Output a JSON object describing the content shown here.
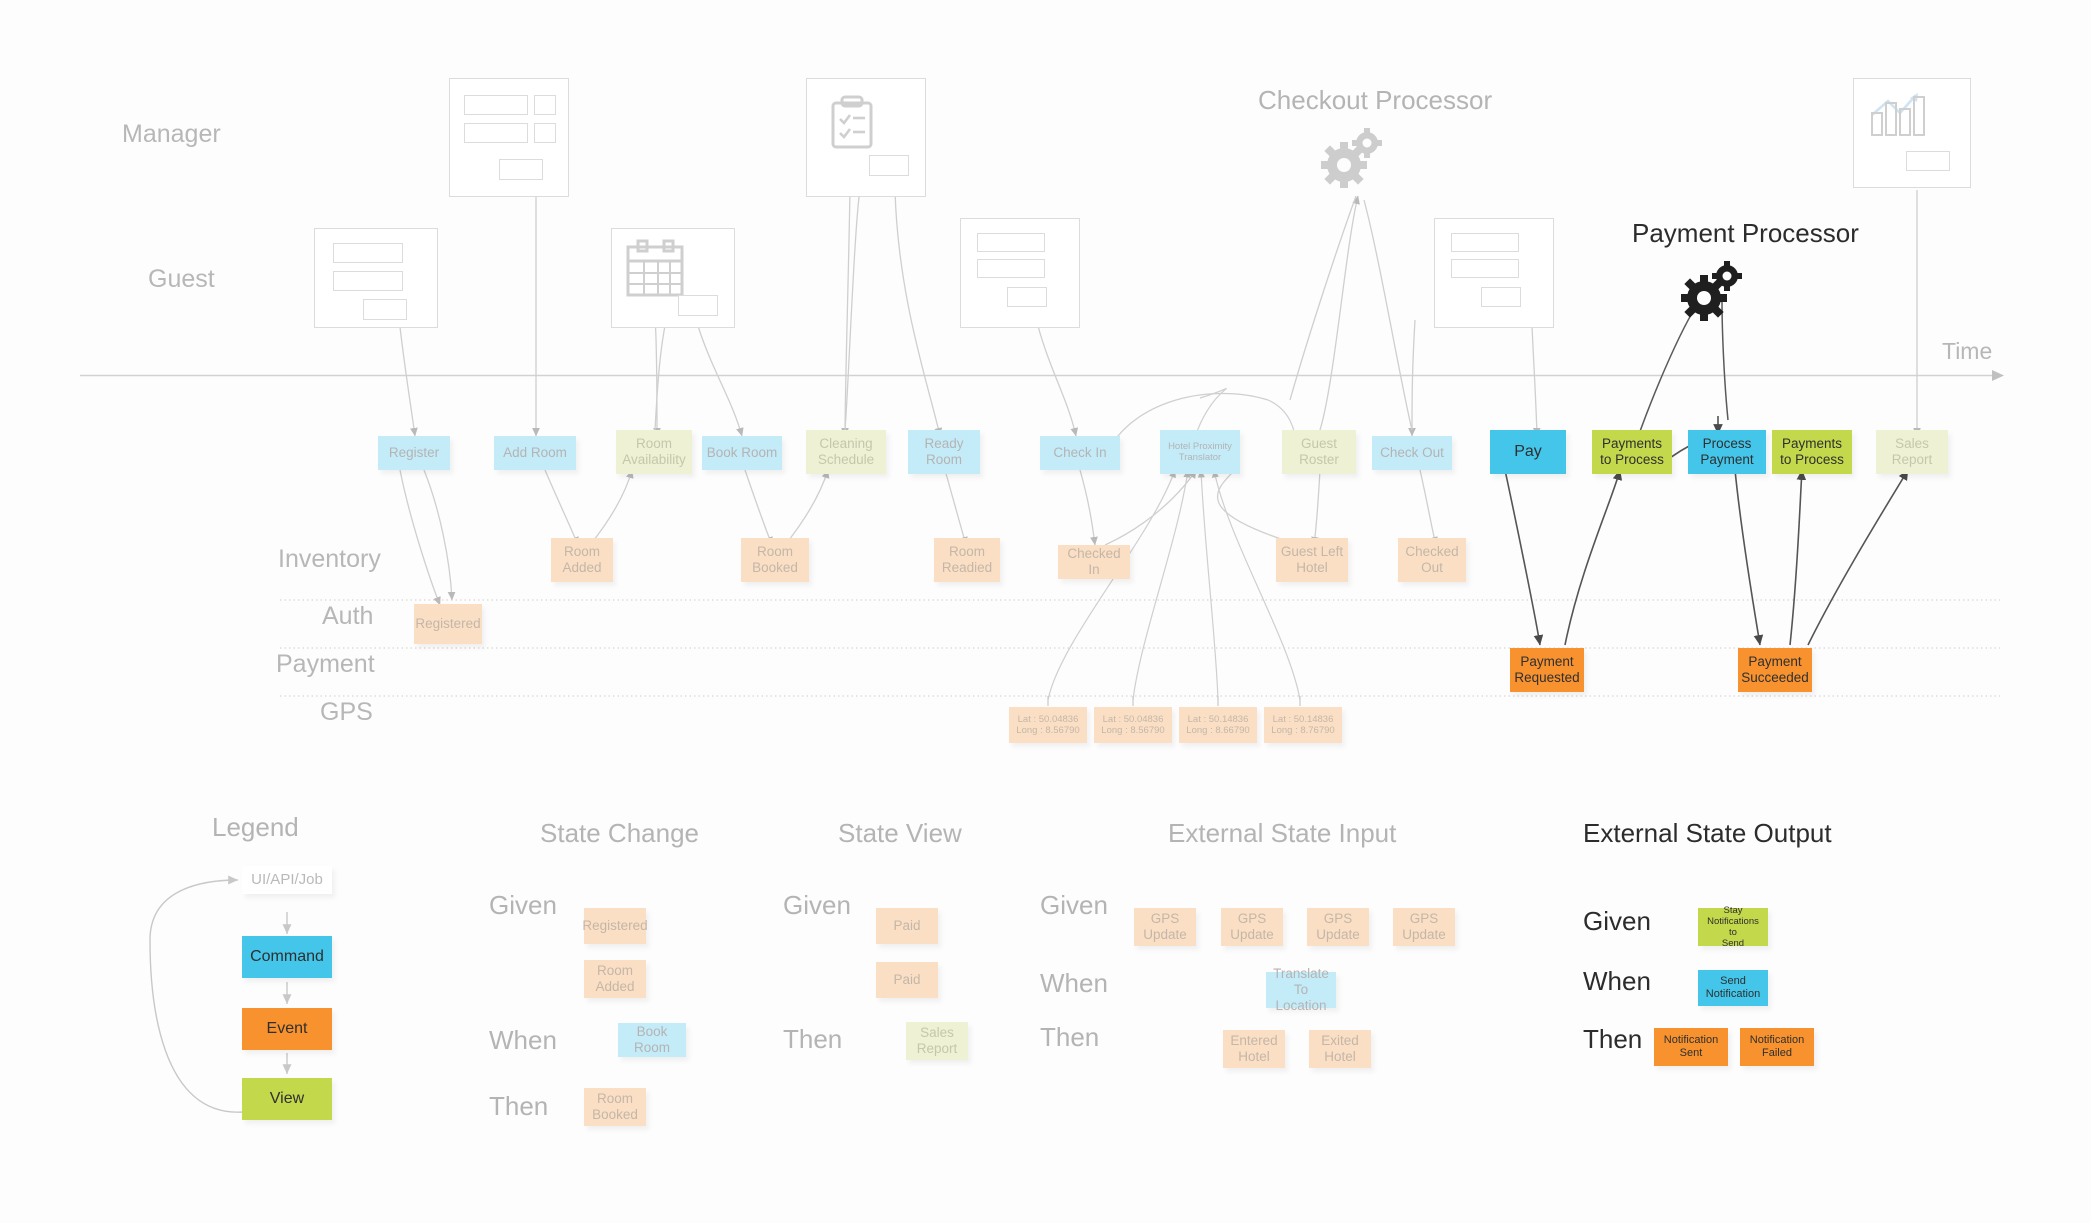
{
  "diagram": {
    "time_axis_label": "Time",
    "lanes": [
      {
        "name": "Manager"
      },
      {
        "name": "Guest"
      },
      {
        "name": "Inventory"
      },
      {
        "name": "Auth"
      },
      {
        "name": "Payment"
      },
      {
        "name": "GPS"
      }
    ],
    "processors": [
      {
        "name": "Checkout Processor",
        "emphasis": "dim"
      },
      {
        "name": "Payment Processor",
        "emphasis": "strong"
      }
    ],
    "timeline_cards": [
      {
        "label": "Register",
        "kind": "command",
        "faded": true
      },
      {
        "label": "Add Room",
        "kind": "command",
        "faded": true
      },
      {
        "label": "Room\nAvailability",
        "kind": "view",
        "faded": true
      },
      {
        "label": "Book Room",
        "kind": "command",
        "faded": true
      },
      {
        "label": "Cleaning\nSchedule",
        "kind": "view",
        "faded": true
      },
      {
        "label": "Ready\nRoom",
        "kind": "command",
        "faded": true
      },
      {
        "label": "Check In",
        "kind": "command",
        "faded": true
      },
      {
        "label": "Hotel Proximity\nTranslator",
        "kind": "command",
        "faded": true
      },
      {
        "label": "Guest\nRoster",
        "kind": "view",
        "faded": true
      },
      {
        "label": "Check Out",
        "kind": "command",
        "faded": true
      },
      {
        "label": "Pay",
        "kind": "command",
        "faded": false
      },
      {
        "label": "Payments\nto Process",
        "kind": "view",
        "faded": false
      },
      {
        "label": "Process\nPayment",
        "kind": "command",
        "faded": false
      },
      {
        "label": "Payments\nto Process",
        "kind": "view",
        "faded": false
      },
      {
        "label": "Sales\nReport",
        "kind": "view",
        "faded": true
      }
    ],
    "inventory_events": [
      {
        "label": "Room\nAdded"
      },
      {
        "label": "Room\nBooked"
      },
      {
        "label": "Room\nReadied"
      },
      {
        "label": "Checked In"
      },
      {
        "label": "Guest Left\nHotel"
      },
      {
        "label": "Checked\nOut"
      }
    ],
    "auth_events": [
      {
        "label": "Registered"
      }
    ],
    "payment_events": [
      {
        "label": "Payment\nRequested"
      },
      {
        "label": "Payment\nSucceeded"
      }
    ],
    "gps_events": [
      {
        "label": "Lat : 50.04836\nLong : 8.56790"
      },
      {
        "label": "Lat : 50.04836\nLong : 8.56790"
      },
      {
        "label": "Lat : 50.14836\nLong : 8.66790"
      },
      {
        "label": "Lat : 50.14836\nLong : 8.76790"
      }
    ]
  },
  "legend": {
    "title": "Legend",
    "items": [
      {
        "label": "UI/API/Job",
        "kind": "uiapi"
      },
      {
        "label": "Command",
        "kind": "command"
      },
      {
        "label": "Event",
        "kind": "event"
      },
      {
        "label": "View",
        "kind": "view"
      }
    ]
  },
  "patterns": [
    {
      "title": "State Change",
      "emphasis": "dim",
      "rows": [
        {
          "label": "Given",
          "cards": [
            {
              "label": "Registered",
              "kind": "event"
            },
            {
              "label": "Room\nAdded",
              "kind": "event"
            }
          ]
        },
        {
          "label": "When",
          "cards": [
            {
              "label": "Book Room",
              "kind": "command"
            }
          ]
        },
        {
          "label": "Then",
          "cards": [
            {
              "label": "Room\nBooked",
              "kind": "event"
            }
          ]
        }
      ]
    },
    {
      "title": "State View",
      "emphasis": "dim",
      "rows": [
        {
          "label": "Given",
          "cards": [
            {
              "label": "Paid",
              "kind": "event"
            },
            {
              "label": "Paid",
              "kind": "event"
            }
          ]
        },
        {
          "label": "Then",
          "cards": [
            {
              "label": "Sales\nReport",
              "kind": "view"
            }
          ]
        }
      ]
    },
    {
      "title": "External State Input",
      "emphasis": "dim",
      "rows": [
        {
          "label": "Given",
          "cards": [
            {
              "label": "GPS\nUpdate",
              "kind": "event"
            },
            {
              "label": "GPS\nUpdate",
              "kind": "event"
            },
            {
              "label": "GPS\nUpdate",
              "kind": "event"
            },
            {
              "label": "GPS\nUpdate",
              "kind": "event"
            }
          ]
        },
        {
          "label": "When",
          "cards": [
            {
              "label": "Translate\nTo Location",
              "kind": "command"
            }
          ]
        },
        {
          "label": "Then",
          "cards": [
            {
              "label": "Entered\nHotel",
              "kind": "event"
            },
            {
              "label": "Exited\nHotel",
              "kind": "event"
            }
          ]
        }
      ]
    },
    {
      "title": "External State Output",
      "emphasis": "strong",
      "rows": [
        {
          "label": "Given",
          "cards": [
            {
              "label": "Stay\nNotifications to\nSend",
              "kind": "view"
            }
          ]
        },
        {
          "label": "When",
          "cards": [
            {
              "label": "Send\nNotification",
              "kind": "command"
            }
          ]
        },
        {
          "label": "Then",
          "cards": [
            {
              "label": "Notification\nSent",
              "kind": "event"
            },
            {
              "label": "Notification\nFailed",
              "kind": "event"
            }
          ]
        }
      ]
    }
  ],
  "colors": {
    "command": "#43c6ea",
    "event": "#f7922f",
    "view": "#c3d84b",
    "command_faded": "#c4ebf8",
    "event_faded": "#fadfc5",
    "view_faded": "#eff1d4",
    "line": "#cfcfcf",
    "text_dim": "#b4b4b4",
    "text_strong": "#2c2c2c"
  }
}
